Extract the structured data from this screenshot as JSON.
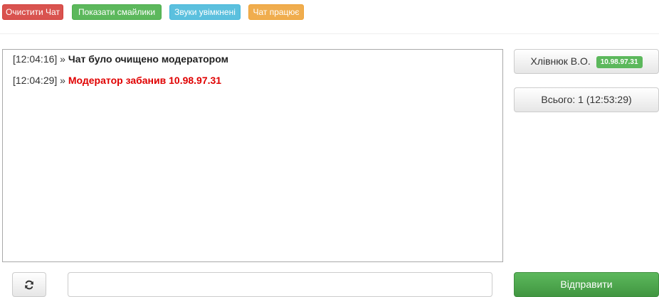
{
  "toolbar": {
    "clear_chat": "Очистити Чат",
    "show_smileys": "Показати смайлики",
    "sounds": "Звуки увімкнені",
    "chat_status": "Чат працює"
  },
  "messages": [
    {
      "time": "[12:04:16]",
      "sep": "»",
      "text": "Чат було очищено модератором",
      "style": "dark"
    },
    {
      "time": "[12:04:29]",
      "sep": "»",
      "text": "Модератор забанив 10.98.97.31",
      "style": "red"
    }
  ],
  "user_panel": {
    "name": "Хлівнюк В.О.",
    "ip": "10.98.97.31",
    "total": "Всього: 1 (12:53:29)"
  },
  "composer": {
    "input_value": "",
    "input_placeholder": "",
    "send_label": "Відправити",
    "refresh_icon": "refresh-icon"
  },
  "colors": {
    "danger": "#d9534f",
    "success": "#5cb85c",
    "info": "#5bc0de",
    "warning": "#f0ad4e",
    "message_red": "#e00000"
  }
}
